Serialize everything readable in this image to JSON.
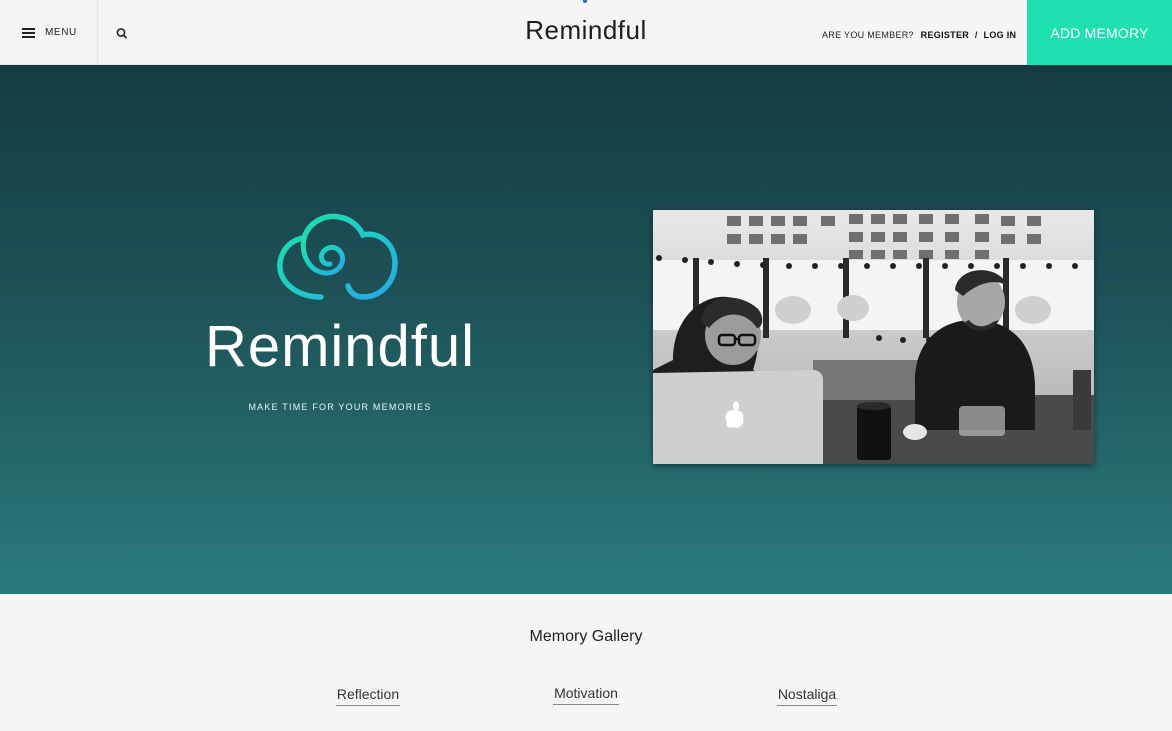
{
  "header": {
    "menu_label": "MENU",
    "brand": "Remindful",
    "member_question": "ARE YOU MEMBER?",
    "register_label": "REGISTER",
    "separator": "/",
    "login_label": "LOG IN",
    "add_memory_label": "ADD MEMORY",
    "accent_color": "#1ee0b0"
  },
  "hero": {
    "title": "Remindful",
    "tagline": "MAKE TIME FOR YOUR MEMORIES",
    "logo_icon": "cloud-swirl-icon",
    "photo_icon": "people-at-laptops-photo"
  },
  "gallery": {
    "title": "Memory Gallery",
    "tabs": [
      {
        "label": "Reflection"
      },
      {
        "label": "Motivation"
      },
      {
        "label": "Nostaliga"
      }
    ]
  }
}
